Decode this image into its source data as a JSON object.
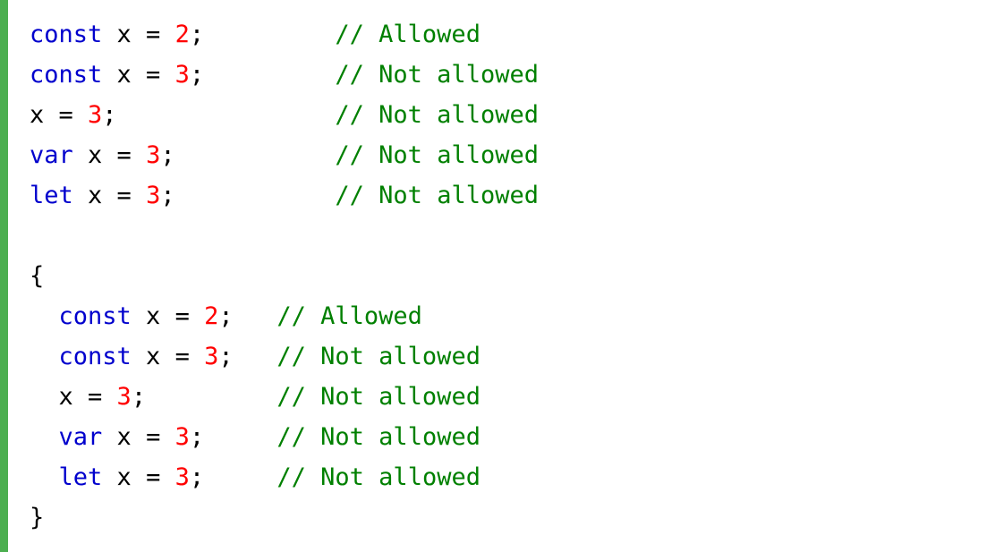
{
  "colors": {
    "accent": "#4CAF50",
    "keyword": "#0000CD",
    "number": "#FF0000",
    "comment": "#008000",
    "plain": "#000000"
  },
  "code": {
    "lines": [
      [
        {
          "t": "const",
          "k": "keyword"
        },
        {
          "t": " x = ",
          "k": "plain"
        },
        {
          "t": "2",
          "k": "number"
        },
        {
          "t": ";         ",
          "k": "plain"
        },
        {
          "t": "// Allowed",
          "k": "comment"
        }
      ],
      [
        {
          "t": "const",
          "k": "keyword"
        },
        {
          "t": " x = ",
          "k": "plain"
        },
        {
          "t": "3",
          "k": "number"
        },
        {
          "t": ";         ",
          "k": "plain"
        },
        {
          "t": "// Not allowed",
          "k": "comment"
        }
      ],
      [
        {
          "t": "x = ",
          "k": "plain"
        },
        {
          "t": "3",
          "k": "number"
        },
        {
          "t": ";               ",
          "k": "plain"
        },
        {
          "t": "// Not allowed",
          "k": "comment"
        }
      ],
      [
        {
          "t": "var",
          "k": "keyword"
        },
        {
          "t": " x = ",
          "k": "plain"
        },
        {
          "t": "3",
          "k": "number"
        },
        {
          "t": ";           ",
          "k": "plain"
        },
        {
          "t": "// Not allowed",
          "k": "comment"
        }
      ],
      [
        {
          "t": "let",
          "k": "keyword"
        },
        {
          "t": " x = ",
          "k": "plain"
        },
        {
          "t": "3",
          "k": "number"
        },
        {
          "t": ";           ",
          "k": "plain"
        },
        {
          "t": "// Not allowed",
          "k": "comment"
        }
      ],
      [],
      [
        {
          "t": "{",
          "k": "plain"
        }
      ],
      [
        {
          "t": "  ",
          "k": "plain"
        },
        {
          "t": "const",
          "k": "keyword"
        },
        {
          "t": " x = ",
          "k": "plain"
        },
        {
          "t": "2",
          "k": "number"
        },
        {
          "t": ";   ",
          "k": "plain"
        },
        {
          "t": "// Allowed",
          "k": "comment"
        }
      ],
      [
        {
          "t": "  ",
          "k": "plain"
        },
        {
          "t": "const",
          "k": "keyword"
        },
        {
          "t": " x = ",
          "k": "plain"
        },
        {
          "t": "3",
          "k": "number"
        },
        {
          "t": ";   ",
          "k": "plain"
        },
        {
          "t": "// Not allowed",
          "k": "comment"
        }
      ],
      [
        {
          "t": "  x = ",
          "k": "plain"
        },
        {
          "t": "3",
          "k": "number"
        },
        {
          "t": ";         ",
          "k": "plain"
        },
        {
          "t": "// Not allowed",
          "k": "comment"
        }
      ],
      [
        {
          "t": "  ",
          "k": "plain"
        },
        {
          "t": "var",
          "k": "keyword"
        },
        {
          "t": " x = ",
          "k": "plain"
        },
        {
          "t": "3",
          "k": "number"
        },
        {
          "t": ";     ",
          "k": "plain"
        },
        {
          "t": "// Not allowed",
          "k": "comment"
        }
      ],
      [
        {
          "t": "  ",
          "k": "plain"
        },
        {
          "t": "let",
          "k": "keyword"
        },
        {
          "t": " x = ",
          "k": "plain"
        },
        {
          "t": "3",
          "k": "number"
        },
        {
          "t": ";     ",
          "k": "plain"
        },
        {
          "t": "// Not allowed",
          "k": "comment"
        }
      ],
      [
        {
          "t": "}",
          "k": "plain"
        }
      ]
    ]
  }
}
